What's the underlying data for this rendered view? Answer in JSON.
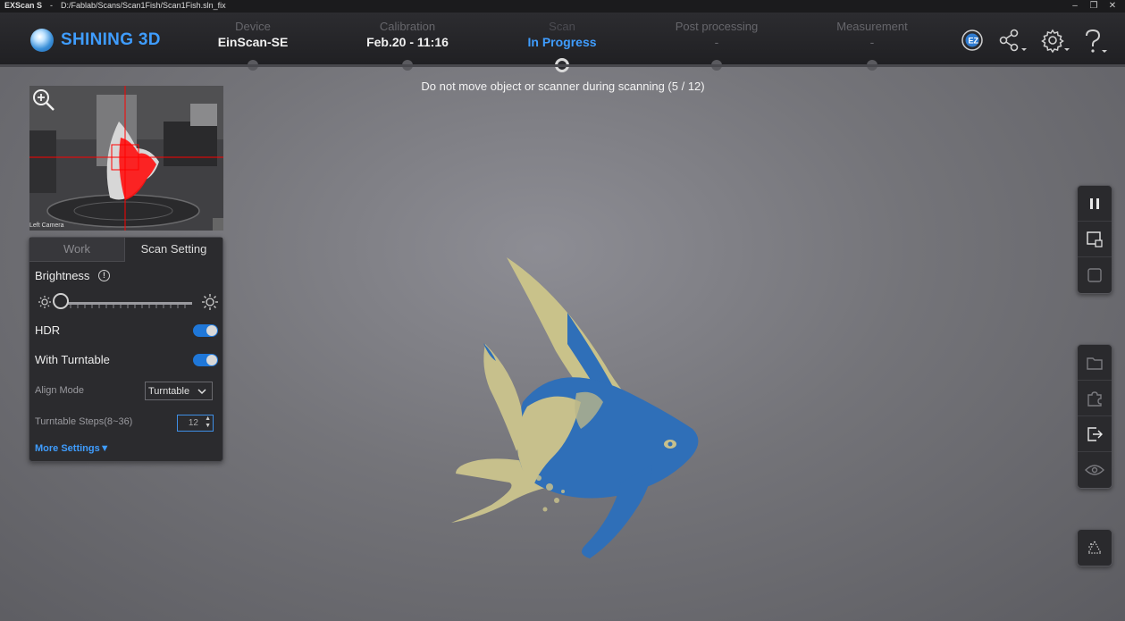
{
  "window": {
    "app_name": "EXScan S",
    "separator": "-",
    "file_path": "D:/Fablab/Scans/Scan1Fish/Scan1Fish.sln_fix",
    "controls": [
      "minimize-icon",
      "restore-icon",
      "close-icon"
    ]
  },
  "brand": {
    "name": "SHINING 3D",
    "color": "#3f9dff"
  },
  "steps": [
    {
      "label": "Device",
      "value": "EinScan-SE",
      "state": "done"
    },
    {
      "label": "Calibration",
      "value": "Feb.20 - 11:16",
      "state": "done"
    },
    {
      "label": "Scan",
      "value": "In Progress",
      "state": "active"
    },
    {
      "label": "Post processing",
      "value": "-",
      "state": "pending"
    },
    {
      "label": "Measurement",
      "value": "-",
      "state": "pending"
    }
  ],
  "top_icons": [
    "ez-logo-icon",
    "share-icon",
    "settings-gear-icon",
    "help-icon"
  ],
  "status_message": "Do not move object or scanner during scanning (5 / 12)",
  "camera": {
    "label": "Left Camera"
  },
  "panel": {
    "tabs": [
      {
        "label": "Work",
        "active": false
      },
      {
        "label": "Scan Setting",
        "active": true
      }
    ],
    "brightness_label": "Brightness",
    "brightness_level": 0.08,
    "hdr_label": "HDR",
    "hdr_on": true,
    "turntable_label": "With Turntable",
    "turntable_on": true,
    "align_mode_label": "Align Mode",
    "align_mode_value": "Turntable",
    "turntable_steps_label": "Turntable Steps(8~36)",
    "turntable_steps_value": "12",
    "more_settings": "More Settings▼"
  },
  "right_toolbar_top": [
    "pause-icon",
    "delete-frame-icon",
    "stop-icon"
  ],
  "right_toolbar_mid": [
    "open-folder-icon",
    "plugin-icon",
    "export-icon",
    "eye-icon"
  ],
  "right_toolbar_bottom": [
    "point-cloud-icon"
  ],
  "colors": {
    "accent": "#3f9dff",
    "scan_blue": "#2f6fb8",
    "scan_yellow": "#c9c28a",
    "mark_red": "#ff0000"
  }
}
